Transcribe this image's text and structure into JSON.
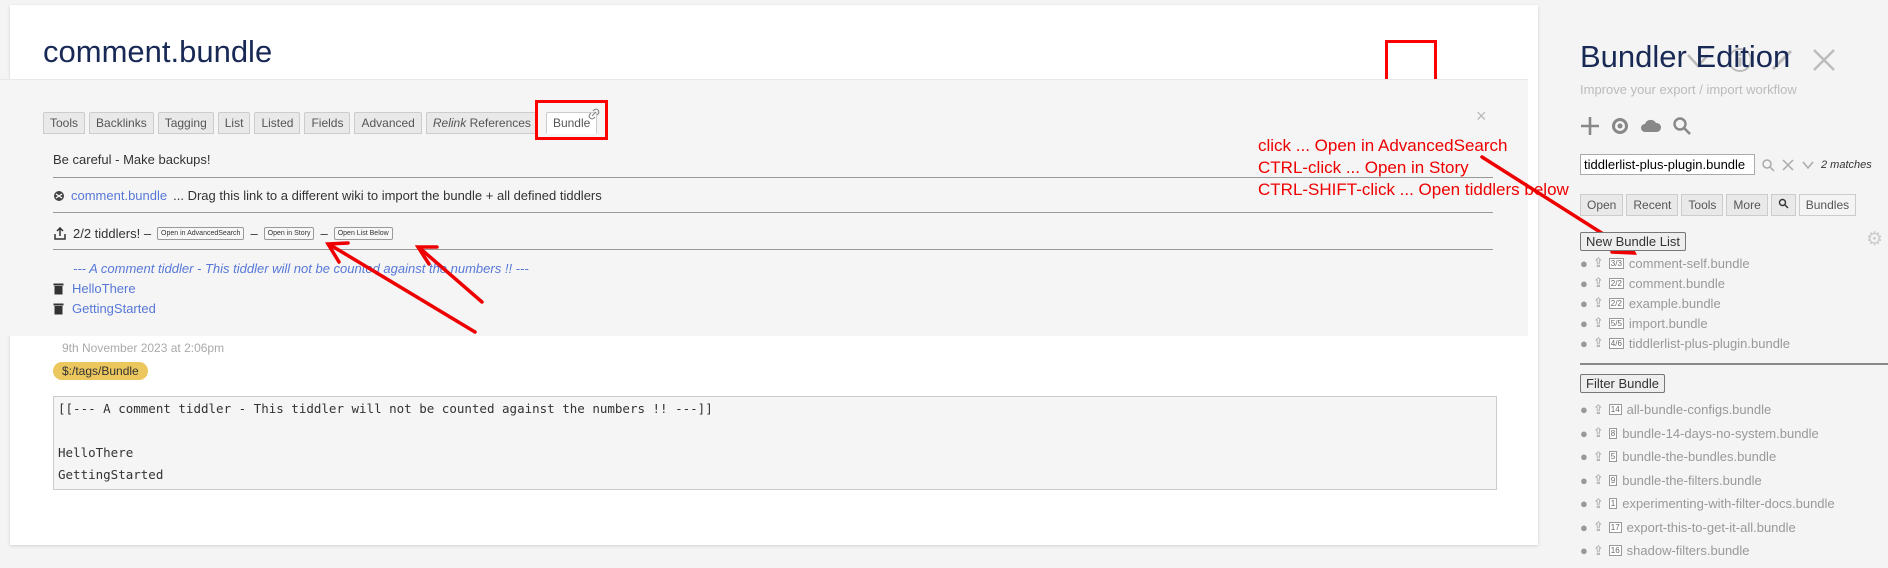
{
  "tiddler": {
    "title": "comment.bundle",
    "tabs": [
      "Tools",
      "Backlinks",
      "Tagging",
      "List",
      "Listed",
      "Fields",
      "Advanced"
    ],
    "relink_tab": {
      "italic": "Relink",
      "rest": "References"
    },
    "active_tab": "Bundle",
    "backup_note": "Be careful - Make backups!",
    "bundle_link": "comment.bundle",
    "drag_text": "... Drag this link to a different wiki to import the bundle + all defined tiddlers",
    "count_text": "2/2 tiddlers! –",
    "dash": "–",
    "btn_advanced_search": "Open in AdvancedSearch",
    "btn_open_story": "Open in Story",
    "btn_list_below": "Open List Below",
    "comment_text": "--- A comment tiddler - This tiddler will not be counted against the numbers !! ---",
    "items": [
      "HelloThere",
      "GettingStarted"
    ],
    "date": "9th November 2023 at 2:06pm",
    "tag": "$:/tags/Bundle",
    "code_lines": [
      "[[--- A comment tiddler - This tiddler will not be counted against the numbers !! ---]]",
      "",
      "HelloThere",
      "GettingStarted"
    ]
  },
  "annotations": [
    "click ... Open in AdvancedSearch",
    "CTRL-click ... Open in Story",
    "CTRL-SHIFT-click ... Open tiddlers below"
  ],
  "sidebar": {
    "site_title": "Bundler Edition",
    "site_subtitle": "Improve your export / import workflow",
    "search_value": "tiddlerlist-plus-plugin.bundle",
    "matches": "2 matches",
    "tabs": [
      "Open",
      "Recent",
      "Tools",
      "More"
    ],
    "active_tab": "Bundles",
    "new_bundle_btn": "New Bundle List",
    "bundles": [
      {
        "count": "3/3",
        "name": "comment-self.bundle"
      },
      {
        "count": "2/2",
        "name": "comment.bundle"
      },
      {
        "count": "2/2",
        "name": "example.bundle"
      },
      {
        "count": "5/5",
        "name": "import.bundle"
      },
      {
        "count": "4/6",
        "name": "tiddlerlist-plus-plugin.bundle"
      }
    ],
    "filter_bundle_btn": "Filter Bundle",
    "filters": [
      {
        "count": "14",
        "name": "all-bundle-configs.bundle"
      },
      {
        "count": "8",
        "name": "bundle-14-days-no-system.bundle"
      },
      {
        "count": "5",
        "name": "bundle-the-bundles.bundle"
      },
      {
        "count": "9",
        "name": "bundle-the-filters.bundle"
      },
      {
        "count": "1",
        "name": "experimenting-with-filter-docs.bundle"
      },
      {
        "count": "17",
        "name": "export-this-to-get-it-all.bundle"
      },
      {
        "count": "16",
        "name": "shadow-filters.bundle"
      }
    ]
  },
  "colors": {
    "accent": "#5778d8",
    "title": "#182955",
    "highlight": "#ff0000",
    "tag": "#ecc75e"
  }
}
